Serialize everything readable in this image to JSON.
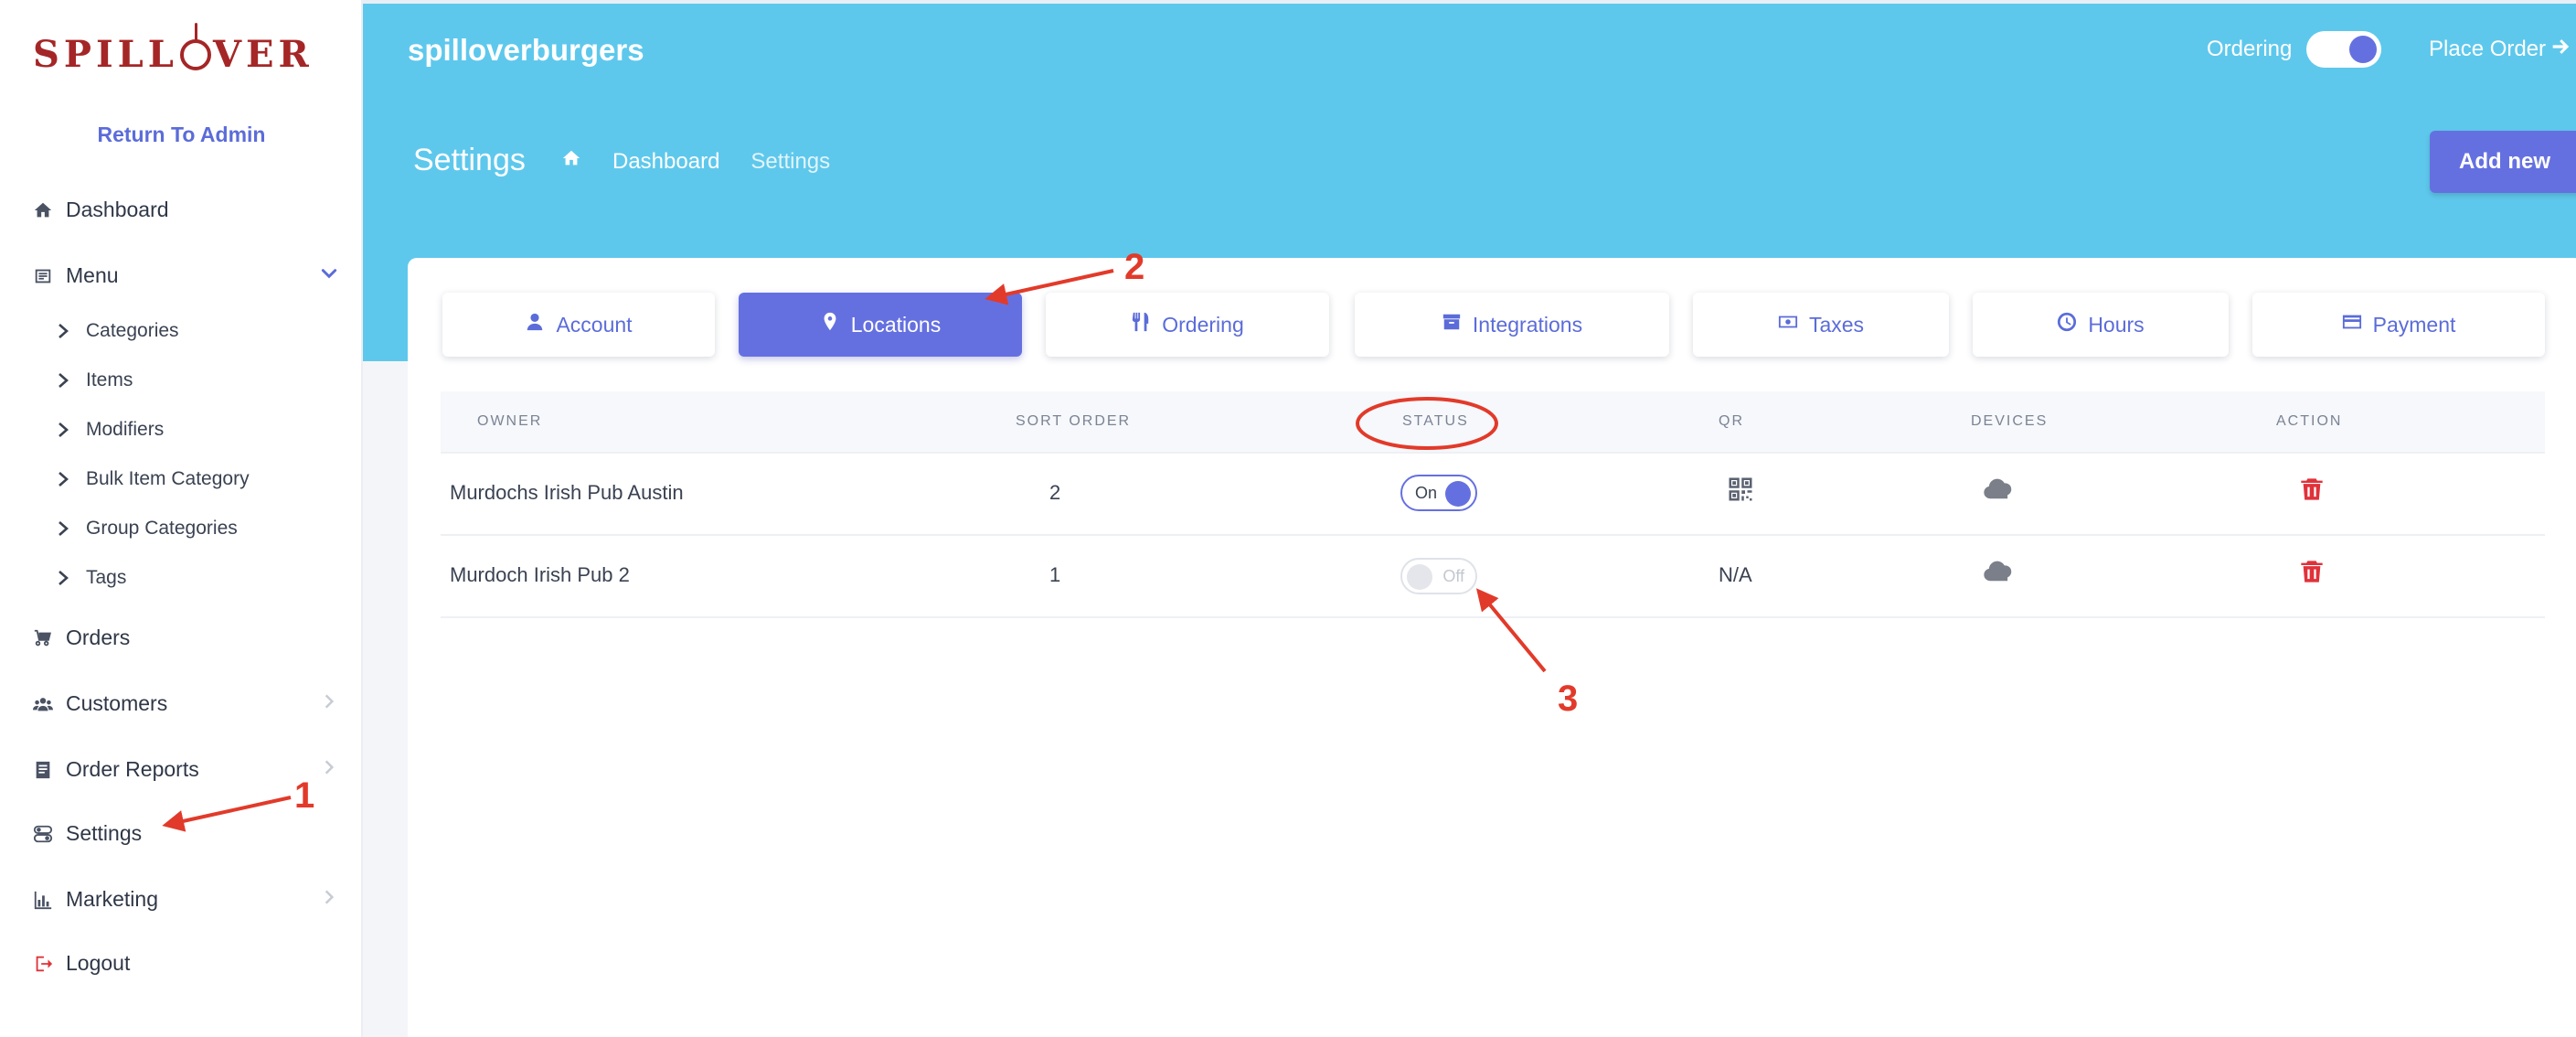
{
  "sidebar": {
    "brand": "SPILLOVER",
    "return_admin": "Return To Admin",
    "items": {
      "dashboard": "Dashboard",
      "menu": "Menu",
      "orders": "Orders",
      "customers": "Customers",
      "order_reports": "Order Reports",
      "settings": "Settings",
      "marketing": "Marketing",
      "logout": "Logout"
    },
    "menu_sub": [
      "Categories",
      "Items",
      "Modifiers",
      "Bulk Item Category",
      "Group Categories",
      "Tags"
    ]
  },
  "header": {
    "restaurant": "spilloverburgers",
    "ordering_label": "Ordering",
    "place_order": "Place Order",
    "page_title": "Settings",
    "breadcrumb": {
      "dashboard": "Dashboard",
      "current": "Settings"
    },
    "add_new": "Add new"
  },
  "tabs": [
    "Account",
    "Locations",
    "Ordering",
    "Integrations",
    "Taxes",
    "Hours",
    "Payment"
  ],
  "table": {
    "columns": [
      "OWNER",
      "SORT ORDER",
      "STATUS",
      "QR",
      "DEVICES",
      "ACTION"
    ],
    "rows": [
      {
        "owner": "Murdochs Irish Pub Austin",
        "sort_order": "2",
        "status": "On",
        "qr": "qr-icon"
      },
      {
        "owner": "Murdoch Irish Pub 2",
        "sort_order": "1",
        "status": "Off",
        "qr": "N/A"
      }
    ]
  },
  "annotations": [
    "1",
    "2",
    "3"
  ],
  "colors": {
    "accent": "#6570e0",
    "band": "#5ec8ec",
    "danger": "#e0323a",
    "annotation": "#e23a2a"
  }
}
